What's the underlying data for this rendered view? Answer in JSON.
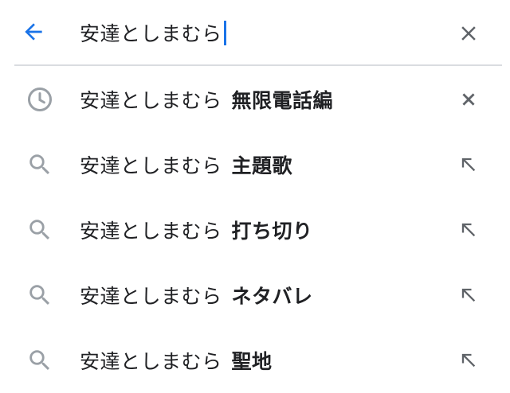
{
  "search": {
    "query": "安達としまむら",
    "caret_color": "#1a73e8"
  },
  "icons": {
    "back": "arrow-left-icon",
    "clear": "close-icon",
    "history": "history-clock-icon",
    "search": "search-icon",
    "remove": "close-icon",
    "fill": "arrow-up-left-icon"
  },
  "colors": {
    "accent": "#1a73e8",
    "icon_gray": "#5f6368",
    "icon_light": "#9aa0a6",
    "divider": "#dadce0"
  },
  "suggestions": [
    {
      "prefix": "安達としまむら",
      "completion": "無限電話編",
      "type": "history"
    },
    {
      "prefix": "安達としまむら",
      "completion": "主題歌",
      "type": "search"
    },
    {
      "prefix": "安達としまむら",
      "completion": "打ち切り",
      "type": "search"
    },
    {
      "prefix": "安達としまむら",
      "completion": "ネタバレ",
      "type": "search"
    },
    {
      "prefix": "安達としまむら",
      "completion": "聖地",
      "type": "search"
    }
  ]
}
